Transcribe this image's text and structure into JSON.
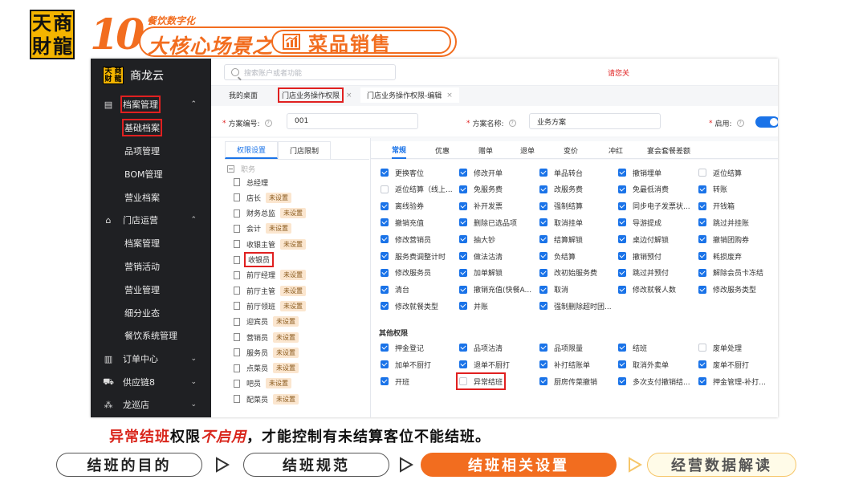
{
  "slide": {
    "logo_chars": [
      "天",
      "商",
      "財",
      "龍"
    ],
    "ten": "10",
    "subtitle": "餐饮数字化",
    "heading": "大核心场景之",
    "heading_topic": "菜品销售",
    "caption": {
      "part1": "异常结班",
      "part2": "权限",
      "part3": "不启用",
      "part4": "，才能控制有未结算客位不能结班。"
    },
    "nav": [
      "结班的目的",
      "结班规范",
      "结班相关设置",
      "经营数据解读"
    ],
    "accent_color": "#f26d1f"
  },
  "app": {
    "brand": {
      "logo_chars": [
        "天",
        "商",
        "财",
        "龍"
      ],
      "name": "商龙云"
    },
    "sidebar": [
      {
        "label": "档案管理",
        "type": "top",
        "icon": "folder-icon",
        "caret": "⌃"
      },
      {
        "label": "基础档案",
        "type": "sub"
      },
      {
        "label": "品项管理",
        "type": "sub"
      },
      {
        "label": "BOM管理",
        "type": "sub"
      },
      {
        "label": "营业档案",
        "type": "sub"
      },
      {
        "label": "门店运营",
        "type": "top",
        "icon": "store-icon",
        "caret": "⌃"
      },
      {
        "label": "档案管理",
        "type": "sub"
      },
      {
        "label": "营销活动",
        "type": "sub"
      },
      {
        "label": "营业管理",
        "type": "sub"
      },
      {
        "label": "细分业态",
        "type": "sub"
      },
      {
        "label": "餐饮系统管理",
        "type": "sub"
      },
      {
        "label": "订单中心",
        "type": "top",
        "icon": "order-icon",
        "caret": "⌄"
      },
      {
        "label": "供应链8",
        "type": "top",
        "icon": "truck-icon",
        "caret": "⌄"
      },
      {
        "label": "龙巡店",
        "type": "top",
        "icon": "patrol-icon",
        "caret": "⌄"
      }
    ],
    "search_placeholder": "搜索账户或者功能",
    "login_link": "请您关",
    "tabs": [
      {
        "label": "我的桌面",
        "closable": false
      },
      {
        "label": "门店业务操作权限",
        "closable": true
      },
      {
        "label": "门店业务操作权限-编辑",
        "closable": true
      }
    ],
    "form": {
      "code_label": "方案编号:",
      "code_value": "001",
      "name_label": "方案名称:",
      "name_value": "业务方案",
      "enable_label": "启用:"
    },
    "sub_tabs": [
      "权限设置",
      "门店限制"
    ],
    "tree_root": "职务",
    "roles": [
      {
        "name": "总经理",
        "badge": ""
      },
      {
        "name": "店长",
        "badge": "未设置"
      },
      {
        "name": "财务总监",
        "badge": "未设置"
      },
      {
        "name": "会计",
        "badge": "未设置"
      },
      {
        "name": "收银主管",
        "badge": "未设置"
      },
      {
        "name": "收银员",
        "badge": ""
      },
      {
        "name": "前厅经理",
        "badge": "未设置"
      },
      {
        "name": "前厅主管",
        "badge": "未设置"
      },
      {
        "name": "前厅领班",
        "badge": "未设置"
      },
      {
        "name": "迎宾员",
        "badge": "未设置"
      },
      {
        "name": "营销员",
        "badge": "未设置"
      },
      {
        "name": "服务员",
        "badge": "未设置"
      },
      {
        "name": "点菜员",
        "badge": "未设置"
      },
      {
        "name": "吧员",
        "badge": "未设置"
      },
      {
        "name": "配菜员",
        "badge": "未设置"
      }
    ],
    "perm_tabs": [
      "常规",
      "优惠",
      "赠单",
      "退单",
      "变价",
      "冲红",
      "宴会套餐差额"
    ],
    "section_other": "其他权限",
    "perm_rows": [
      [
        {
          "l": "更换客位",
          "c": true
        },
        {
          "l": "修改开单",
          "c": true
        },
        {
          "l": "单品转台",
          "c": true
        },
        {
          "l": "撤销埋单",
          "c": true
        },
        {
          "l": "返位结算",
          "c": false
        }
      ],
      [
        {
          "l": "返位结算（线上...",
          "c": false
        },
        {
          "l": "免服务费",
          "c": true
        },
        {
          "l": "改服务费",
          "c": true
        },
        {
          "l": "免最低消费",
          "c": true
        },
        {
          "l": "转账",
          "c": true
        }
      ],
      [
        {
          "l": "离线验券",
          "c": true
        },
        {
          "l": "补开发票",
          "c": true
        },
        {
          "l": "强制结算",
          "c": true
        },
        {
          "l": "同步电子发票状...",
          "c": true
        },
        {
          "l": "开钱箱",
          "c": true
        }
      ],
      [
        {
          "l": "撤销充值",
          "c": true
        },
        {
          "l": "删除已选品项",
          "c": true
        },
        {
          "l": "取消挂单",
          "c": true
        },
        {
          "l": "导游提成",
          "c": true
        },
        {
          "l": "跳过并挂账",
          "c": true
        }
      ],
      [
        {
          "l": "修改营销员",
          "c": true
        },
        {
          "l": "抽大钞",
          "c": true
        },
        {
          "l": "结算解锁",
          "c": true
        },
        {
          "l": "桌边付解锁",
          "c": true
        },
        {
          "l": "撤销团购券",
          "c": true
        }
      ],
      [
        {
          "l": "服务费调整计时",
          "c": true
        },
        {
          "l": "做法沽清",
          "c": true
        },
        {
          "l": "负结算",
          "c": true
        },
        {
          "l": "撤销预付",
          "c": true
        },
        {
          "l": "耗损废弃",
          "c": true
        }
      ],
      [
        {
          "l": "修改服务员",
          "c": true
        },
        {
          "l": "加单解锁",
          "c": true
        },
        {
          "l": "改初始服务费",
          "c": true
        },
        {
          "l": "跳过并预付",
          "c": true
        },
        {
          "l": "解除会员卡冻结",
          "c": true
        }
      ],
      [
        {
          "l": "清台",
          "c": true
        },
        {
          "l": "撤销充值(快餐A...",
          "c": true
        },
        {
          "l": "取消",
          "c": true
        },
        {
          "l": "修改就餐人数",
          "c": true
        },
        {
          "l": "修改服务类型",
          "c": true
        }
      ],
      [
        {
          "l": "修改就餐类型",
          "c": true
        },
        {
          "l": "并账",
          "c": true
        },
        {
          "l": "强制删除超时团...",
          "c": true
        }
      ]
    ],
    "other_rows": [
      [
        {
          "l": "押金登记",
          "c": true
        },
        {
          "l": "品项沽清",
          "c": true
        },
        {
          "l": "品项限量",
          "c": true
        },
        {
          "l": "结班",
          "c": true
        },
        {
          "l": "废单处理",
          "c": false
        }
      ],
      [
        {
          "l": "加单不厨打",
          "c": true
        },
        {
          "l": "退单不厨打",
          "c": true
        },
        {
          "l": "补打结账单",
          "c": true
        },
        {
          "l": "取消外卖单",
          "c": true
        },
        {
          "l": "废单不厨打",
          "c": true
        }
      ],
      [
        {
          "l": "开班",
          "c": true
        },
        {
          "l": "异常结班",
          "c": false,
          "hl": true
        },
        {
          "l": "厨房传菜撤销",
          "c": true
        },
        {
          "l": "多次支付撤销结...",
          "c": true
        },
        {
          "l": "押金管理-补打...",
          "c": true
        }
      ]
    ]
  }
}
